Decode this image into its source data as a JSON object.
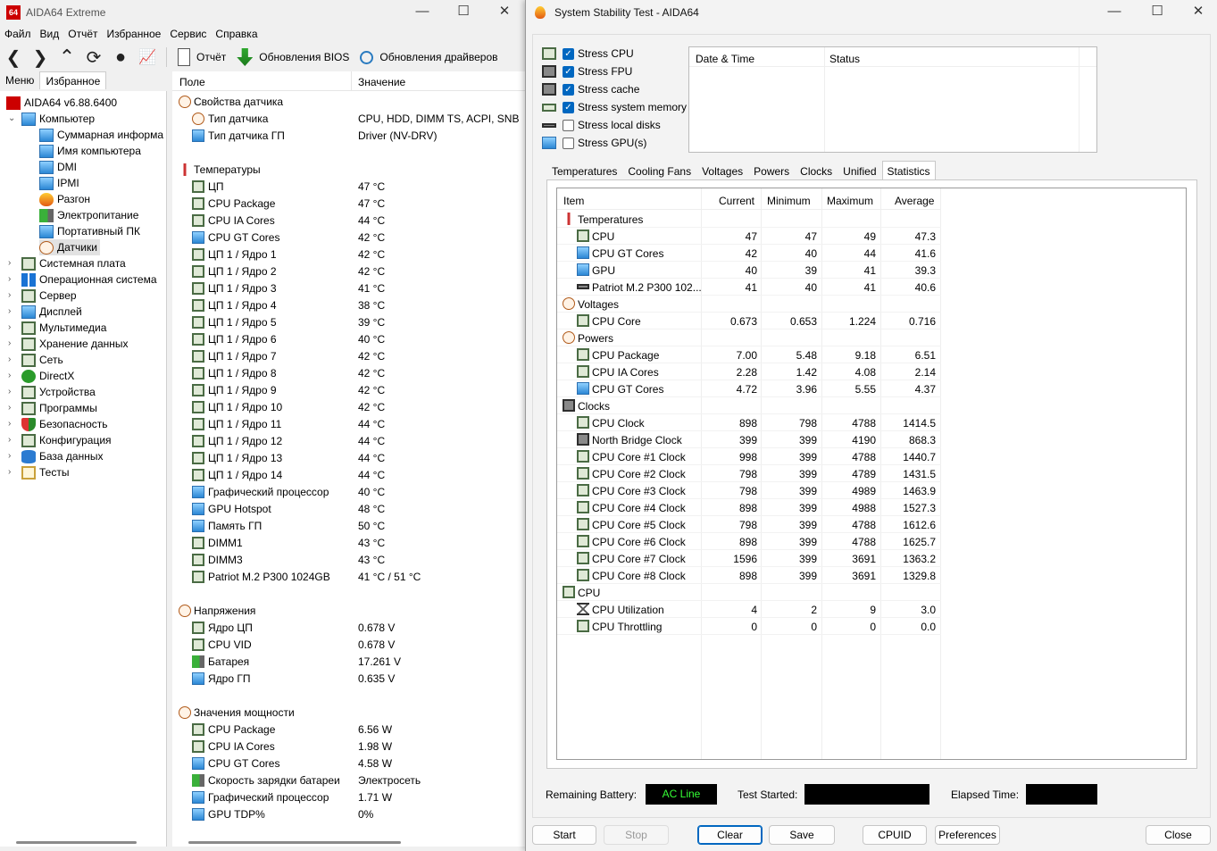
{
  "main_window": {
    "title": "AIDA64 Extreme",
    "app_icon_text": "64",
    "menu": [
      "Файл",
      "Вид",
      "Отчёт",
      "Избранное",
      "Сервис",
      "Справка"
    ],
    "toolbar": {
      "report": "Отчёт",
      "bios_updates": "Обновления BIOS",
      "driver_updates": "Обновления драйверов"
    },
    "tabs": [
      "Меню",
      "Избранное"
    ],
    "tree": [
      {
        "label": "AIDA64 v6.88.6400",
        "level": 0,
        "icon": "aida64-icon"
      },
      {
        "label": "Компьютер",
        "level": 1,
        "icon": "computer-icon",
        "expanded": true
      },
      {
        "label": "Суммарная информа",
        "level": 2,
        "icon": "monitor-icon"
      },
      {
        "label": "Имя компьютера",
        "level": 2,
        "icon": "monitor-icon"
      },
      {
        "label": "DMI",
        "level": 2,
        "icon": "monitor-icon"
      },
      {
        "label": "IPMI",
        "level": 2,
        "icon": "monitor-icon"
      },
      {
        "label": "Разгон",
        "level": 2,
        "icon": "flame-icon"
      },
      {
        "label": "Электропитание",
        "level": 2,
        "icon": "battery-icon"
      },
      {
        "label": "Портативный ПК",
        "level": 2,
        "icon": "laptop-icon"
      },
      {
        "label": "Датчики",
        "level": 2,
        "icon": "gauge-icon",
        "selected": true
      },
      {
        "label": "Системная плата",
        "level": 1,
        "icon": "motherboard-icon"
      },
      {
        "label": "Операционная система",
        "level": 1,
        "icon": "windows-icon"
      },
      {
        "label": "Сервер",
        "level": 1,
        "icon": "server-icon"
      },
      {
        "label": "Дисплей",
        "level": 1,
        "icon": "display-icon"
      },
      {
        "label": "Мультимедиа",
        "level": 1,
        "icon": "speaker-icon"
      },
      {
        "label": "Хранение данных",
        "level": 1,
        "icon": "storage-icon"
      },
      {
        "label": "Сеть",
        "level": 1,
        "icon": "network-icon"
      },
      {
        "label": "DirectX",
        "level": 1,
        "icon": "xbox-icon"
      },
      {
        "label": "Устройства",
        "level": 1,
        "icon": "devices-icon"
      },
      {
        "label": "Программы",
        "level": 1,
        "icon": "programs-icon"
      },
      {
        "label": "Безопасность",
        "level": 1,
        "icon": "shield-icon"
      },
      {
        "label": "Конфигурация",
        "level": 1,
        "icon": "config-icon"
      },
      {
        "label": "База данных",
        "level": 1,
        "icon": "database-icon"
      },
      {
        "label": "Тесты",
        "level": 1,
        "icon": "tests-icon"
      }
    ],
    "list_header": {
      "field": "Поле",
      "value": "Значение"
    },
    "list_rows": [
      {
        "group": true,
        "field": "Свойства датчика",
        "icon": "gauge-icon"
      },
      {
        "field": "Тип датчика",
        "value": "CPU, HDD, DIMM TS, ACPI, SNB",
        "icon": "gauge-icon"
      },
      {
        "field": "Тип датчика ГП",
        "value": "Driver  (NV-DRV)",
        "icon": "monitor-icon"
      },
      {
        "blank": true
      },
      {
        "group": true,
        "field": "Температуры",
        "icon": "thermometer-icon"
      },
      {
        "field": "ЦП",
        "value": "47 °C",
        "icon": "chip-icon"
      },
      {
        "field": "CPU Package",
        "value": "47 °C",
        "icon": "chip-icon"
      },
      {
        "field": "CPU IA Cores",
        "value": "44 °C",
        "icon": "chip-icon"
      },
      {
        "field": "CPU GT Cores",
        "value": "42 °C",
        "icon": "monitor-icon"
      },
      {
        "field": "ЦП 1 / Ядро 1",
        "value": "42 °C",
        "icon": "chip-icon"
      },
      {
        "field": "ЦП 1 / Ядро 2",
        "value": "42 °C",
        "icon": "chip-icon"
      },
      {
        "field": "ЦП 1 / Ядро 3",
        "value": "41 °C",
        "icon": "chip-icon"
      },
      {
        "field": "ЦП 1 / Ядро 4",
        "value": "38 °C",
        "icon": "chip-icon"
      },
      {
        "field": "ЦП 1 / Ядро 5",
        "value": "39 °C",
        "icon": "chip-icon"
      },
      {
        "field": "ЦП 1 / Ядро 6",
        "value": "40 °C",
        "icon": "chip-icon"
      },
      {
        "field": "ЦП 1 / Ядро 7",
        "value": "42 °C",
        "icon": "chip-icon"
      },
      {
        "field": "ЦП 1 / Ядро 8",
        "value": "42 °C",
        "icon": "chip-icon"
      },
      {
        "field": "ЦП 1 / Ядро 9",
        "value": "42 °C",
        "icon": "chip-icon"
      },
      {
        "field": "ЦП 1 / Ядро 10",
        "value": "42 °C",
        "icon": "chip-icon"
      },
      {
        "field": "ЦП 1 / Ядро 11",
        "value": "44 °C",
        "icon": "chip-icon"
      },
      {
        "field": "ЦП 1 / Ядро 12",
        "value": "44 °C",
        "icon": "chip-icon"
      },
      {
        "field": "ЦП 1 / Ядро 13",
        "value": "44 °C",
        "icon": "chip-icon"
      },
      {
        "field": "ЦП 1 / Ядро 14",
        "value": "44 °C",
        "icon": "chip-icon"
      },
      {
        "field": "Графический процессор",
        "value": "40 °C",
        "icon": "monitor-icon"
      },
      {
        "field": "GPU Hotspot",
        "value": "48 °C",
        "icon": "monitor-icon"
      },
      {
        "field": "Память ГП",
        "value": "50 °C",
        "icon": "monitor-icon"
      },
      {
        "field": "DIMM1",
        "value": "43 °C",
        "icon": "ram-icon"
      },
      {
        "field": "DIMM3",
        "value": "43 °C",
        "icon": "ram-icon"
      },
      {
        "field": "Patriot M.2 P300 1024GB",
        "value": "41 °C / 51 °C",
        "icon": "disk-icon"
      },
      {
        "blank": true
      },
      {
        "group": true,
        "field": "Напряжения",
        "icon": "bolt-icon"
      },
      {
        "field": "Ядро ЦП",
        "value": "0.678 V",
        "icon": "chip-icon"
      },
      {
        "field": "CPU VID",
        "value": "0.678 V",
        "icon": "chip-icon"
      },
      {
        "field": "Батарея",
        "value": "17.261 V",
        "icon": "battery-icon"
      },
      {
        "field": "Ядро ГП",
        "value": "0.635 V",
        "icon": "monitor-icon"
      },
      {
        "blank": true
      },
      {
        "group": true,
        "field": "Значения мощности",
        "icon": "bolt-icon"
      },
      {
        "field": "CPU Package",
        "value": "6.56 W",
        "icon": "chip-icon"
      },
      {
        "field": "CPU IA Cores",
        "value": "1.98 W",
        "icon": "chip-icon"
      },
      {
        "field": "CPU GT Cores",
        "value": "4.58 W",
        "icon": "monitor-icon"
      },
      {
        "field": "Скорость зарядки батареи",
        "value": "Электросеть",
        "icon": "battery-icon"
      },
      {
        "field": "Графический процессор",
        "value": "1.71 W",
        "icon": "monitor-icon"
      },
      {
        "field": "GPU TDP%",
        "value": "0%",
        "icon": "monitor-icon"
      }
    ]
  },
  "stability_window": {
    "title": "System Stability Test - AIDA64",
    "stress_options": [
      {
        "label": "Stress CPU",
        "checked": true,
        "icon": "chip-icon"
      },
      {
        "label": "Stress FPU",
        "checked": true,
        "icon": "fpu-icon"
      },
      {
        "label": "Stress cache",
        "checked": true,
        "icon": "cache-icon"
      },
      {
        "label": "Stress system memory",
        "checked": true,
        "icon": "ram-icon"
      },
      {
        "label": "Stress local disks",
        "checked": false,
        "icon": "disk-icon"
      },
      {
        "label": "Stress GPU(s)",
        "checked": false,
        "icon": "monitor-icon"
      }
    ],
    "log_header": {
      "date": "Date & Time",
      "status": "Status"
    },
    "tabs": [
      "Temperatures",
      "Cooling Fans",
      "Voltages",
      "Powers",
      "Clocks",
      "Unified",
      "Statistics"
    ],
    "active_tab": "Statistics",
    "stats_header": {
      "item": "Item",
      "current": "Current",
      "minimum": "Minimum",
      "maximum": "Maximum",
      "average": "Average"
    },
    "stats_rows": [
      {
        "group": true,
        "name": "Temperatures",
        "icon": "thermometer-icon"
      },
      {
        "name": "CPU",
        "cur": "47",
        "min": "47",
        "max": "49",
        "avg": "47.3",
        "icon": "chip-icon"
      },
      {
        "name": "CPU GT Cores",
        "cur": "42",
        "min": "40",
        "max": "44",
        "avg": "41.6",
        "icon": "monitor-icon"
      },
      {
        "name": "GPU",
        "cur": "40",
        "min": "39",
        "max": "41",
        "avg": "39.3",
        "icon": "monitor-icon"
      },
      {
        "name": "Patriot M.2 P300 102...",
        "cur": "41",
        "min": "40",
        "max": "41",
        "avg": "40.6",
        "icon": "disk-icon"
      },
      {
        "group": true,
        "name": "Voltages",
        "icon": "bolt-icon"
      },
      {
        "name": "CPU Core",
        "cur": "0.673",
        "min": "0.653",
        "max": "1.224",
        "avg": "0.716",
        "icon": "chip-icon"
      },
      {
        "group": true,
        "name": "Powers",
        "icon": "bolt-icon"
      },
      {
        "name": "CPU Package",
        "cur": "7.00",
        "min": "5.48",
        "max": "9.18",
        "avg": "6.51",
        "icon": "chip-icon"
      },
      {
        "name": "CPU IA Cores",
        "cur": "2.28",
        "min": "1.42",
        "max": "4.08",
        "avg": "2.14",
        "icon": "chip-icon"
      },
      {
        "name": "CPU GT Cores",
        "cur": "4.72",
        "min": "3.96",
        "max": "5.55",
        "avg": "4.37",
        "icon": "monitor-icon"
      },
      {
        "group": true,
        "name": "Clocks",
        "icon": "clock-chip-icon"
      },
      {
        "name": "CPU Clock",
        "cur": "898",
        "min": "798",
        "max": "4788",
        "avg": "1414.5",
        "icon": "chip-icon"
      },
      {
        "name": "North Bridge Clock",
        "cur": "399",
        "min": "399",
        "max": "4190",
        "avg": "868.3",
        "icon": "chip2-icon"
      },
      {
        "name": "CPU Core #1 Clock",
        "cur": "998",
        "min": "399",
        "max": "4788",
        "avg": "1440.7",
        "icon": "chip-icon"
      },
      {
        "name": "CPU Core #2 Clock",
        "cur": "798",
        "min": "399",
        "max": "4789",
        "avg": "1431.5",
        "icon": "chip-icon"
      },
      {
        "name": "CPU Core #3 Clock",
        "cur": "798",
        "min": "399",
        "max": "4989",
        "avg": "1463.9",
        "icon": "chip-icon"
      },
      {
        "name": "CPU Core #4 Clock",
        "cur": "898",
        "min": "399",
        "max": "4988",
        "avg": "1527.3",
        "icon": "chip-icon"
      },
      {
        "name": "CPU Core #5 Clock",
        "cur": "798",
        "min": "399",
        "max": "4788",
        "avg": "1612.6",
        "icon": "chip-icon"
      },
      {
        "name": "CPU Core #6 Clock",
        "cur": "898",
        "min": "399",
        "max": "4788",
        "avg": "1625.7",
        "icon": "chip-icon"
      },
      {
        "name": "CPU Core #7 Clock",
        "cur": "1596",
        "min": "399",
        "max": "3691",
        "avg": "1363.2",
        "icon": "chip-icon"
      },
      {
        "name": "CPU Core #8 Clock",
        "cur": "898",
        "min": "399",
        "max": "3691",
        "avg": "1329.8",
        "icon": "chip-icon"
      },
      {
        "group": true,
        "name": "CPU",
        "icon": "chip-icon"
      },
      {
        "name": "CPU Utilization",
        "cur": "4",
        "min": "2",
        "max": "9",
        "avg": "3.0",
        "icon": "hourglass-icon"
      },
      {
        "name": "CPU Throttling",
        "cur": "0",
        "min": "0",
        "max": "0",
        "avg": "0.0",
        "icon": "chip-icon"
      }
    ],
    "footer": {
      "remaining_battery": "Remaining Battery:",
      "battery_value": "AC Line",
      "test_started": "Test Started:",
      "elapsed_time": "Elapsed Time:"
    },
    "buttons": {
      "start": "Start",
      "stop": "Stop",
      "clear": "Clear",
      "save": "Save",
      "cpuid": "CPUID",
      "preferences": "Preferences",
      "close": "Close"
    }
  },
  "colors": {
    "accent": "#0067c0",
    "battery_text": "#35ff35",
    "aida_red": "#c00000"
  }
}
